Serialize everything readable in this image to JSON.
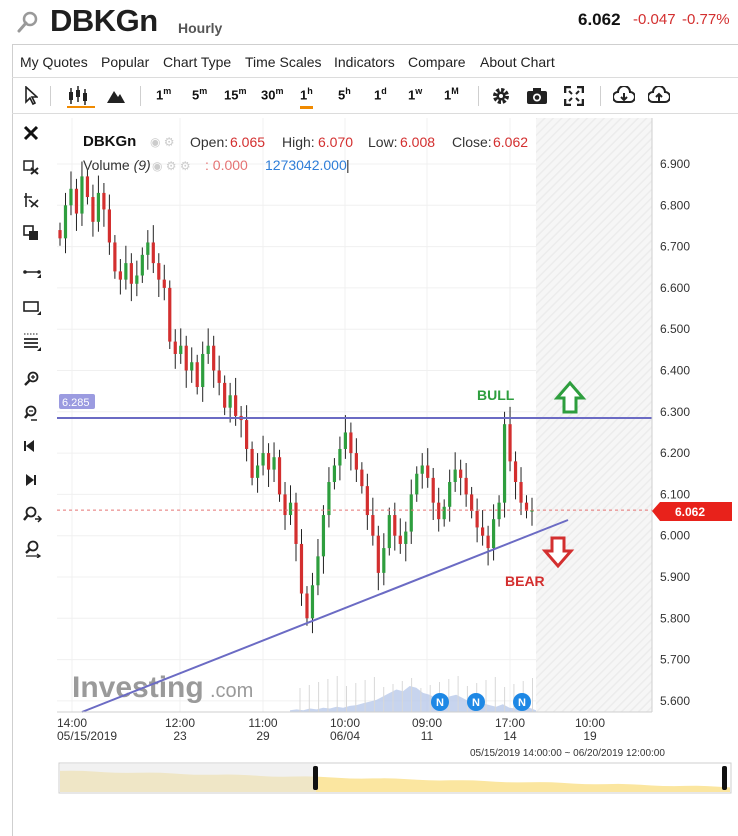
{
  "header": {
    "symbol": "DBKGn",
    "period": "Hourly",
    "last": "6.062",
    "change": "-0.047",
    "change_pct": "-0.77%"
  },
  "menu": {
    "items": [
      "My Quotes",
      "Popular",
      "Chart Type",
      "Time Scales",
      "Indicators",
      "Compare",
      "About Chart"
    ]
  },
  "toolbar": {
    "timeframes": [
      {
        "num": "1",
        "unit": "m"
      },
      {
        "num": "5",
        "unit": "m"
      },
      {
        "num": "15",
        "unit": "m"
      },
      {
        "num": "30",
        "unit": "m"
      },
      {
        "num": "1",
        "unit": "h"
      },
      {
        "num": "5",
        "unit": "h"
      },
      {
        "num": "1",
        "unit": "d"
      },
      {
        "num": "1",
        "unit": "w"
      },
      {
        "num": "1",
        "unit": "M"
      }
    ],
    "selected": "1h",
    "icons": [
      "cursor-icon",
      "candlestick-icon",
      "mountain-icon",
      "gear-icon",
      "camera-icon",
      "fullscreen-icon",
      "download-icon",
      "upload-icon"
    ]
  },
  "sidebar": {
    "icons": [
      "close-icon",
      "erase-icon",
      "crosshair-icon",
      "copy-icon",
      "line-icon",
      "rectangle-icon",
      "fibonacci-icon",
      "zoom-in-icon",
      "zoom-out-icon",
      "scroll-left-icon",
      "scroll-right-icon",
      "zoom-fit-icon",
      "zoom-reset-icon"
    ]
  },
  "legend": {
    "symbol": "DBKGn",
    "open_label": "Open:",
    "open": "6.065",
    "high_label": "High:",
    "high": "6.070",
    "low_label": "Low:",
    "low": "6.008",
    "close_label": "Close:",
    "close": "6.062",
    "volume_label": "Volume",
    "volume_param": "(9)",
    "volume_value": ": 0.000",
    "volume_ma": "1273042.000"
  },
  "annotations": {
    "bull": "BULL",
    "bear": "BEAR",
    "resistance_tag": "6.285",
    "price_tag": "6.062",
    "watermark": "Investing",
    "watermark_suffix": ".com",
    "news_badge": "N"
  },
  "navigator": {
    "range_text": "05/15/2019 14:00:00 ~ 06/20/2019 12:00:00"
  },
  "colors": {
    "up": "#2e9e3e",
    "down": "#d32f2f",
    "trendline": "#6b6bc4",
    "bull": "#2e9e3e",
    "bear": "#d32f2f",
    "accent": "#f08a00",
    "news": "#1e88e5"
  },
  "chart_data": {
    "type": "candlestick",
    "ylim": [
      5.55,
      6.97
    ],
    "yticks": [
      "6.900",
      "6.800",
      "6.700",
      "6.600",
      "6.500",
      "6.400",
      "6.300",
      "6.200",
      "6.100",
      "6.000",
      "5.900",
      "5.800",
      "5.700",
      "5.600"
    ],
    "xticks": [
      {
        "top": "14:00",
        "bottom": "05/15/2019"
      },
      {
        "top": "12:00",
        "bottom": "23"
      },
      {
        "top": "11:00",
        "bottom": "29"
      },
      {
        "top": "10:00",
        "bottom": "06/04"
      },
      {
        "top": "09:00",
        "bottom": "11"
      },
      {
        "top": "17:00",
        "bottom": "14"
      },
      {
        "top": "10:00",
        "bottom": "19"
      }
    ],
    "resistance": 6.285,
    "current_price": 6.062,
    "support_trendline": [
      [
        0,
        5.53
      ],
      [
        95,
        5.98
      ]
    ],
    "closes": [
      6.72,
      6.8,
      6.84,
      6.78,
      6.87,
      6.82,
      6.76,
      6.83,
      6.79,
      6.71,
      6.64,
      6.62,
      6.66,
      6.61,
      6.63,
      6.68,
      6.71,
      6.66,
      6.62,
      6.6,
      6.47,
      6.44,
      6.46,
      6.4,
      6.42,
      6.36,
      6.44,
      6.46,
      6.4,
      6.37,
      6.31,
      6.34,
      6.29,
      6.28,
      6.21,
      6.14,
      6.17,
      6.2,
      6.16,
      6.19,
      6.1,
      6.05,
      6.08,
      5.98,
      5.86,
      5.8,
      5.88,
      5.95,
      6.05,
      6.13,
      6.17,
      6.21,
      6.25,
      6.2,
      6.16,
      6.12,
      6.05,
      6.0,
      5.91,
      5.97,
      6.05,
      6.0,
      5.98,
      6.01,
      6.1,
      6.15,
      6.17,
      6.14,
      6.08,
      6.04,
      6.07,
      6.13,
      6.16,
      6.14,
      6.1,
      6.06,
      6.02,
      6.0,
      5.97,
      6.04,
      6.08,
      6.27,
      6.18,
      6.13,
      6.08,
      6.06,
      6.062
    ],
    "volumes": [
      2,
      3,
      2,
      4,
      3,
      5,
      4,
      6,
      5,
      7,
      8,
      10,
      12,
      14,
      18,
      22,
      26,
      24,
      30,
      28,
      22,
      20,
      16,
      14,
      18,
      20,
      16,
      12,
      14,
      10,
      8,
      6,
      9,
      5,
      4,
      3,
      5,
      2
    ]
  }
}
